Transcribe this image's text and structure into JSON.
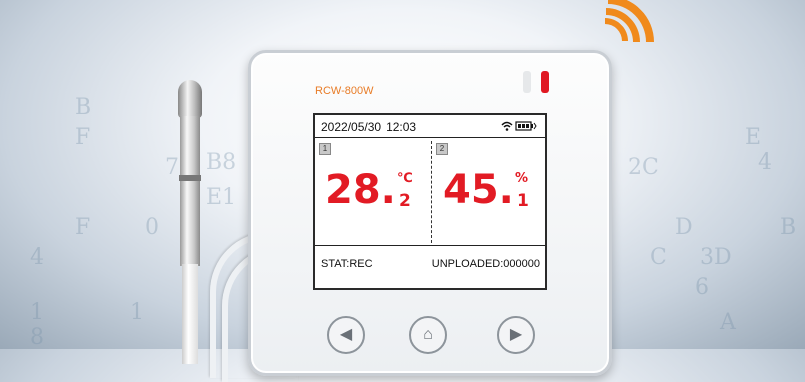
{
  "device": {
    "model": "RCW-800W",
    "colors": {
      "accent": "#e87c27",
      "reading": "#e21b24",
      "led": "#e01822"
    }
  },
  "screen": {
    "date": "2022/05/30",
    "time": "12:03",
    "channel1": {
      "id": "1",
      "value_int": "28.",
      "value_dec": "2",
      "unit": "℃"
    },
    "channel2": {
      "id": "2",
      "value_int": "45.",
      "value_dec": "1",
      "unit": "%"
    },
    "status": "STAT:REC",
    "uploaded": "UNPLOADED:000000"
  },
  "buttons": {
    "left_icon": "◀",
    "home_icon": "⌂",
    "right_icon": "▶"
  },
  "background_glyphs": [
    "B",
    "F",
    "7",
    "B8",
    "E1",
    "F",
    "0",
    "4",
    "1",
    "8",
    "2C",
    "C",
    "3D",
    "A",
    "E",
    "B",
    "D",
    "6",
    "1",
    "4"
  ]
}
